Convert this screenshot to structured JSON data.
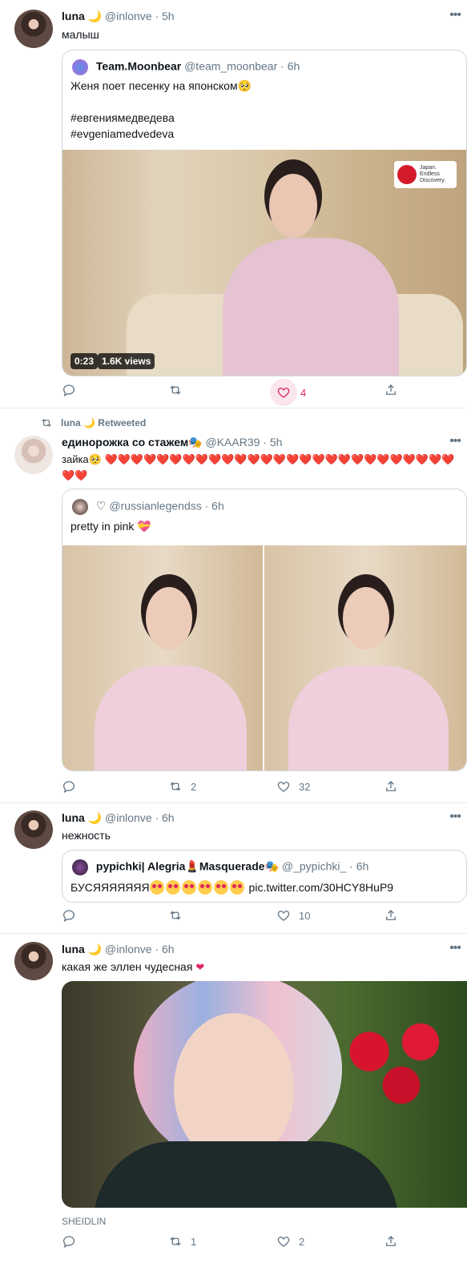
{
  "tweets": [
    {
      "name": "luna 🌙",
      "handle": "@inlonve · 5h",
      "text": "малыш",
      "quote": {
        "name": "Team.Moonbear",
        "handle": "@team_moonbear · 6h",
        "text": "Женя поет песенку на японском🥺\n\n#евгениямедведева\n#evgeniamedvedeva",
        "video_time": "0:23",
        "video_views": "1.6K views",
        "watermark": "Japan. Endless Discovery."
      },
      "actions": {
        "reply": "",
        "retweet": "",
        "like": "4",
        "share": ""
      }
    },
    {
      "retweeted_by": "luna 🌙 Retweeted",
      "name": "единорожка со стажем🎭",
      "handle": "@KAAR39 · 5h",
      "text": "зайка🥺 ❤️❤️❤️❤️❤️❤️❤️❤️❤️❤️❤️❤️❤️❤️❤️❤️❤️❤️❤️❤️❤️❤️❤️❤️❤️❤️❤️❤️❤️",
      "quote": {
        "name": "♡",
        "handle": "@russianlegendss · 6h",
        "text": "pretty in pink 💝"
      },
      "actions": {
        "reply": "",
        "retweet": "2",
        "like": "32",
        "share": ""
      }
    },
    {
      "name": "luna 🌙",
      "handle": "@inlonve · 6h",
      "text": "нежность",
      "quote": {
        "name": "pypichki| Alegria💄Masquerade🎭",
        "handle": "@_pypichki_ · 6h",
        "text": "БУСЯЯЯЯЯЯЯ",
        "link": "pic.twitter.com/30HCY8HuP9"
      },
      "actions": {
        "reply": "",
        "retweet": "",
        "like": "10",
        "share": ""
      }
    },
    {
      "name": "luna 🌙",
      "handle": "@inlonve · 6h",
      "text": "какая же эллен чудесная",
      "caption": "SHEIDLIN",
      "actions": {
        "reply": "",
        "retweet": "1",
        "like": "2",
        "share": ""
      }
    }
  ],
  "colors": {
    "like": "#e0245e",
    "muted": "#657786",
    "border": "#cfd9de"
  },
  "icons": [
    "reply-icon",
    "retweet-icon",
    "like-icon",
    "share-icon",
    "more-icon"
  ]
}
